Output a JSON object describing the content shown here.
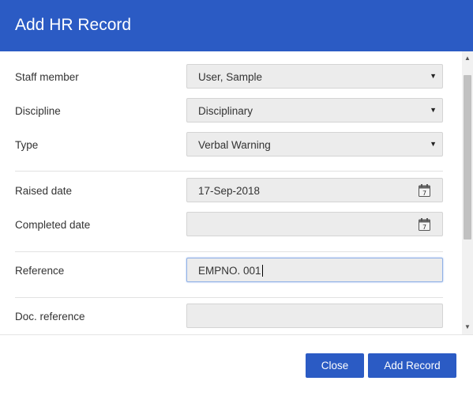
{
  "dialog": {
    "title": "Add HR Record"
  },
  "form": {
    "staff_member": {
      "label": "Staff member",
      "value": "User, Sample"
    },
    "discipline": {
      "label": "Discipline",
      "value": "Disciplinary"
    },
    "type": {
      "label": "Type",
      "value": "Verbal Warning"
    },
    "raised_date": {
      "label": "Raised date",
      "value": "17-Sep-2018"
    },
    "completed_date": {
      "label": "Completed date",
      "value": ""
    },
    "reference": {
      "label": "Reference",
      "value": "EMPNO. 001"
    },
    "doc_reference": {
      "label": "Doc. reference",
      "value": ""
    }
  },
  "footer": {
    "close_label": "Close",
    "add_label": "Add Record"
  },
  "icons": {
    "dropdown": "caret-down-icon",
    "calendar": "calendar-icon"
  },
  "colors": {
    "accent": "#2b5bc4",
    "field_bg": "#ececec"
  }
}
